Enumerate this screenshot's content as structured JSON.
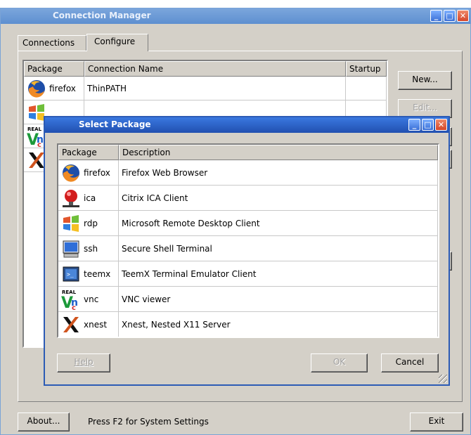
{
  "main": {
    "title": "Connection Manager",
    "tabs": [
      "Connections",
      "Configure"
    ],
    "list": {
      "headers": [
        "Package",
        "Connection Name",
        "Startup"
      ],
      "rows": [
        {
          "icon": "firefox-icon",
          "package": "firefox",
          "name": "ThinPATH",
          "startup": ""
        },
        {
          "icon": "windows-icon",
          "package": "",
          "name": "",
          "startup": ""
        },
        {
          "icon": "vnc-icon",
          "package": "",
          "name": "",
          "startup": ""
        },
        {
          "icon": "x-icon",
          "package": "",
          "name": "",
          "startup": ""
        }
      ]
    },
    "buttons": {
      "new": "New...",
      "edit": "Edit...",
      "about": "About...",
      "exit": "Exit"
    },
    "status": "Press F2 for System Settings"
  },
  "dialog": {
    "title": "Select Package",
    "headers": [
      "Package",
      "Description"
    ],
    "rows": [
      {
        "icon": "firefox-icon",
        "package": "firefox",
        "description": "Firefox Web Browser"
      },
      {
        "icon": "citrix-ica-icon",
        "package": "ica",
        "description": "Citrix ICA Client"
      },
      {
        "icon": "windows-icon",
        "package": "rdp",
        "description": "Microsoft Remote Desktop Client"
      },
      {
        "icon": "terminal-monitor-icon",
        "package": "ssh",
        "description": "Secure Shell Terminal"
      },
      {
        "icon": "teemx-icon",
        "package": "teemx",
        "description": "TeemX Terminal Emulator Client"
      },
      {
        "icon": "vnc-icon",
        "package": "vnc",
        "description": "VNC viewer"
      },
      {
        "icon": "x-icon",
        "package": "xnest",
        "description": "Xnest, Nested X11 Server"
      }
    ],
    "buttons": {
      "help": "Help",
      "ok": "OK",
      "cancel": "Cancel"
    }
  },
  "colors": {
    "titlebar": "#2458b0",
    "panel": "#d4d0c8",
    "dialog_border": "#2c5bb5"
  }
}
